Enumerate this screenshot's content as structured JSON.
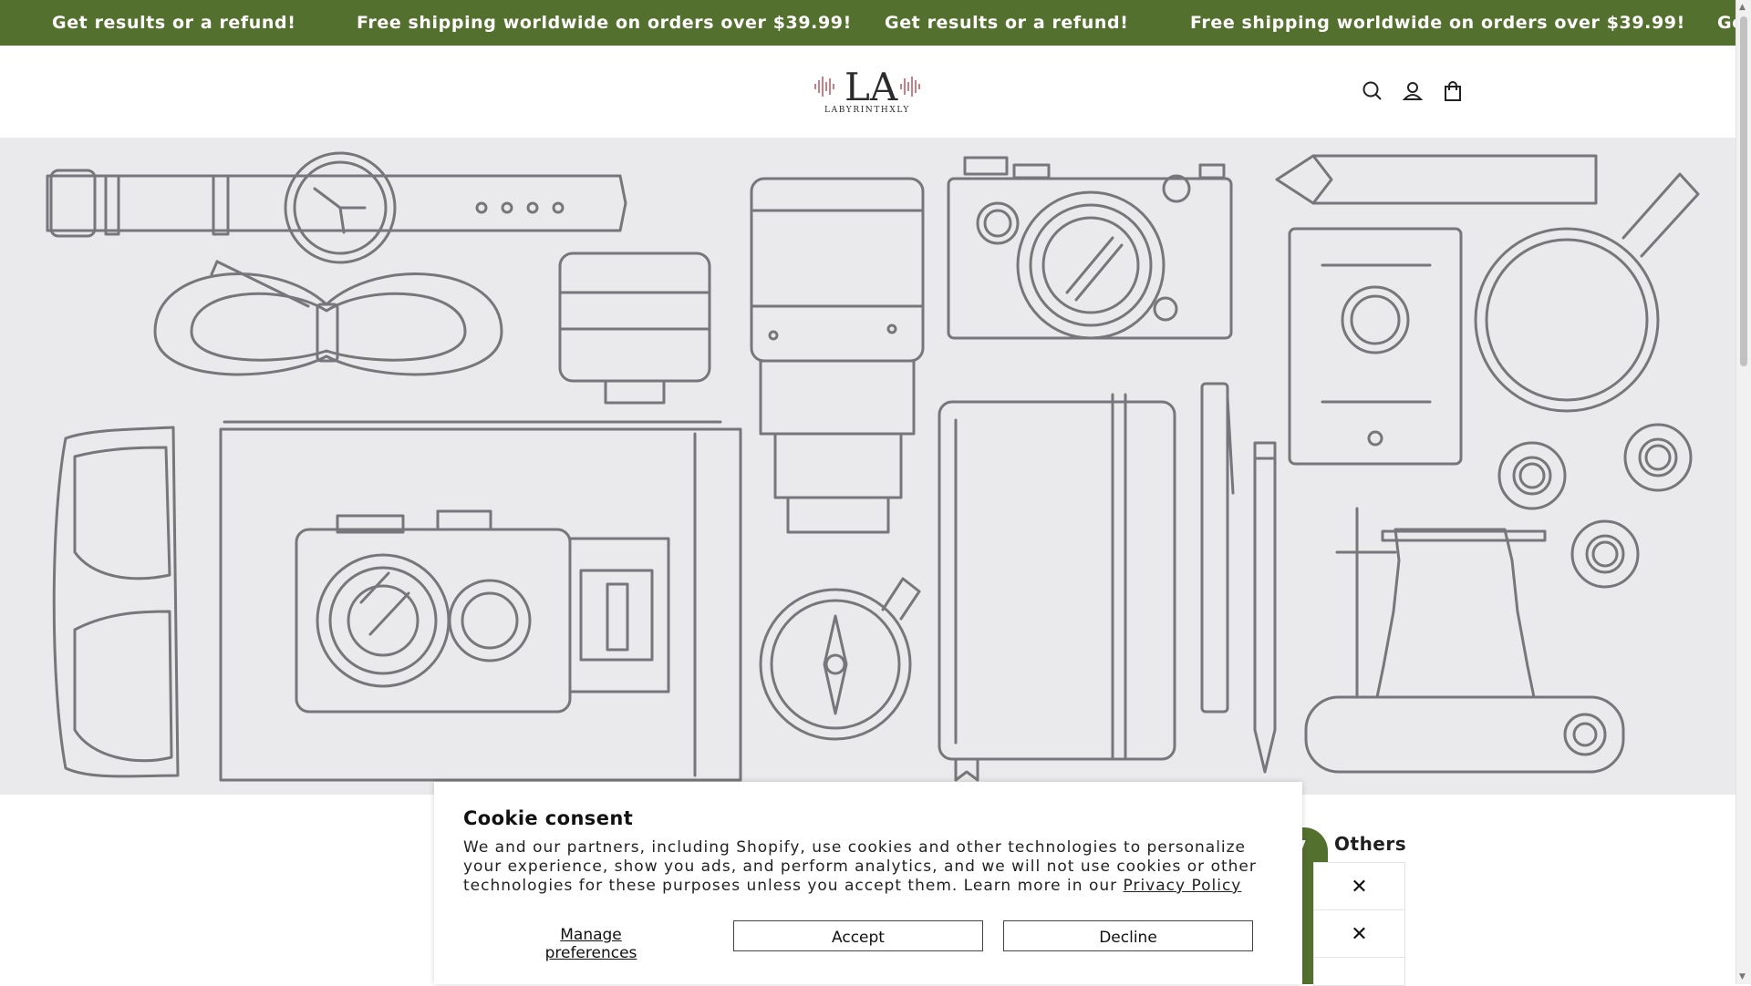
{
  "announcement": {
    "messages": [
      "Get results or a refund!",
      "Free shipping worldwide on orders over $39.99!",
      "Get results or a refund!",
      "Free shipping worldwide on orders over $39.99!",
      "Ge"
    ]
  },
  "header": {
    "logo_monogram": "LA",
    "logo_text": "LABYRINTHXLY"
  },
  "tabs": {
    "active_partial": "ly",
    "others": "Others"
  },
  "close_glyph": "✕",
  "cookie": {
    "title": "Cookie consent",
    "body": "We and our partners, including Shopify, use cookies and other technologies to personalize your experience, show you ads, and perform analytics, and we will not use cookies or other technologies for these purposes unless you accept them. Learn more in our ",
    "link": "Privacy Policy",
    "manage": "Manage preferences",
    "accept": "Accept",
    "decline": "Decline"
  },
  "colors": {
    "brand_green": "#54702e",
    "hero_bg": "#eaeaec",
    "line_art": "#77777b"
  }
}
